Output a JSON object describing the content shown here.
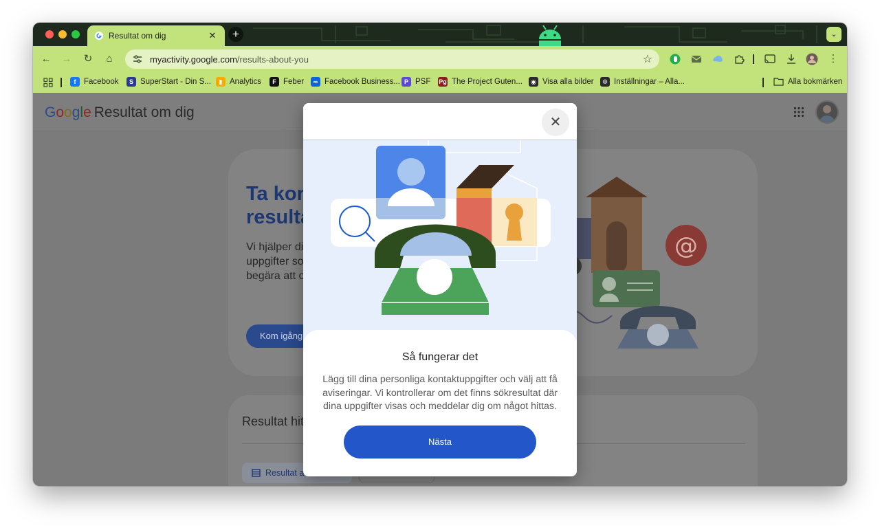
{
  "tab": {
    "title": "Resultat om dig",
    "close": "✕"
  },
  "newtab": "+",
  "toolbar": {
    "back": "←",
    "forward": "→",
    "reload": "↻",
    "home": "⌂",
    "url_domain": "myactivity.google.com",
    "url_path": "/results-about-you",
    "star": "☆"
  },
  "bookmarks": [
    {
      "label": "Facebook",
      "icon": "facebook-icon",
      "color": "#1877f2",
      "glyph": "f"
    },
    {
      "label": "SuperStart - Din S...",
      "icon": "superstart-icon",
      "color": "#2b3a8c",
      "glyph": "S"
    },
    {
      "label": "Analytics",
      "icon": "analytics-icon",
      "color": "#f9ab00",
      "glyph": "▮"
    },
    {
      "label": "Feber",
      "icon": "feber-icon",
      "color": "#111111",
      "glyph": "F"
    },
    {
      "label": "Facebook Business...",
      "icon": "meta-icon",
      "color": "#0a66d8",
      "glyph": "∞"
    },
    {
      "label": "PSF",
      "icon": "psf-icon",
      "color": "#5b4ad6",
      "glyph": "P"
    },
    {
      "label": "The Project Guten...",
      "icon": "gutenberg-icon",
      "color": "#8b1c1c",
      "glyph": "Pg"
    },
    {
      "label": "Visa alla bilder",
      "icon": "globe-icon",
      "color": "#2a2a2a",
      "glyph": "◉"
    },
    {
      "label": "Inställningar – Alla...",
      "icon": "gear-icon",
      "color": "#2a2a2a",
      "glyph": "⚙"
    }
  ],
  "bookmarks_all": "Alla bokmärken",
  "page": {
    "brand_product": "Resultat om dig",
    "hero_title": "Ta kont\nresulta",
    "hero_text": "Vi hjälper dig\nuppgifter so\nbegära att o",
    "hero_button": "Kom igång",
    "results_title": "Resultat hitt",
    "chip_label": "Resultat a"
  },
  "modal": {
    "close": "✕",
    "title": "Så fungerar det",
    "body": "Lägg till dina personliga kontaktuppgifter och välj att få aviseringar. Vi kontrollerar om det finns sökresultat där dina uppgifter visas och meddelar dig om något hittas.",
    "next": "Nästa"
  },
  "colors": {
    "chrome_theme": "#c2e27b",
    "primary_button": "#2256c9",
    "overlay": "#7b7b7b"
  }
}
